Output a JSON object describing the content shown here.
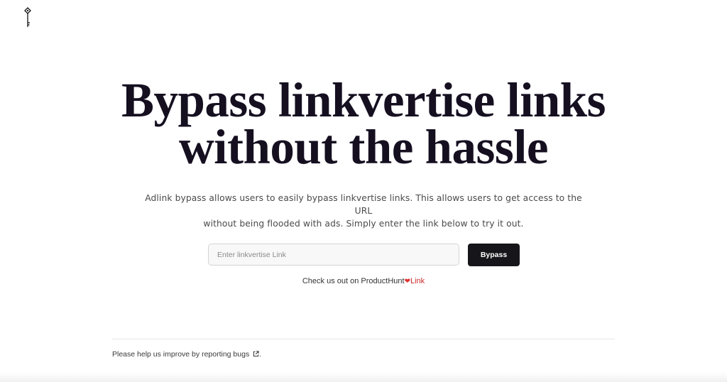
{
  "header": {
    "logo_icon": "key-icon"
  },
  "hero": {
    "title_line1": "Bypass linkvertise links",
    "title_line2": "without the hassle",
    "subtitle_line1": "Adlink bypass allows users to easily bypass linkvertise links. This allows users to get access to the URL",
    "subtitle_line2": "without being flooded with ads. Simply enter the link below to try it out."
  },
  "form": {
    "input_placeholder": "Enter linkvertise Link",
    "input_value": "",
    "button_label": "Bypass"
  },
  "producthunt": {
    "text": "Check us out on ProductHunt",
    "heart_icon": "heart-icon",
    "link_label": "Link"
  },
  "footer": {
    "text": "Please help us improve by reporting bugs",
    "external_icon": "external-link-icon",
    "suffix": "."
  },
  "colors": {
    "title": "#150f20",
    "button_bg": "#16161a",
    "link": "#c92a2a",
    "heart": "#e03131"
  }
}
